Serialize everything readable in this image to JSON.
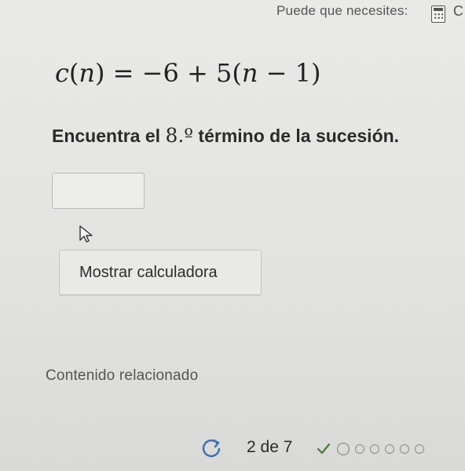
{
  "hint": {
    "text": "Puede que necesites:",
    "tool_icon": "calculator-icon",
    "trailing_text": "C"
  },
  "question": {
    "formula": {
      "lhs_fn": "c",
      "lhs_var": "n",
      "rhs_prefix": "= −6 + 5(",
      "rhs_var": "n",
      "rhs_suffix": " − 1)"
    },
    "prompt_before": "Encuentra el ",
    "prompt_ordinal": "8.º",
    "prompt_after": " término de la sucesión.",
    "answer_value": "",
    "calculator_button_label": "Mostrar calculadora"
  },
  "related": {
    "title": "Contenido relacionado"
  },
  "progress": {
    "text": "2 de 7",
    "completed_count": 1,
    "current_index": 2,
    "total": 7
  },
  "colors": {
    "background": "#e4e4e2",
    "check": "#4a7a3a",
    "text": "#2a2a2a"
  }
}
